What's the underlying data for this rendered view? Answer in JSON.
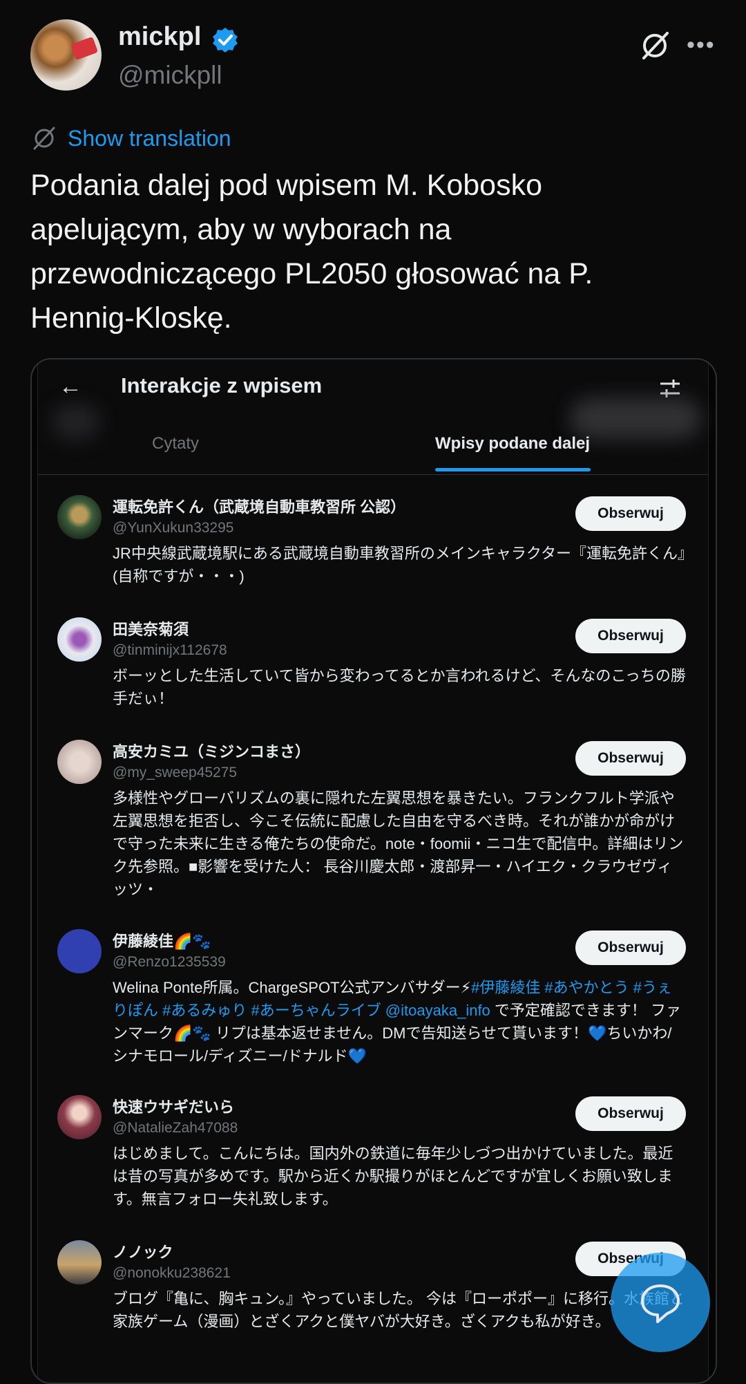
{
  "author": {
    "display_name": "mickpl",
    "handle": "@mickpll"
  },
  "translation": {
    "link_label": "Show translation"
  },
  "tweet": {
    "text": "Podania dalej pod wpisem M. Kobosko apelującym, aby w wyborach na przewodniczącego PL2050 głosować na P. Hennig-Kloskę."
  },
  "embedded": {
    "title": "Interakcje z wpisem",
    "tabs": [
      {
        "label": "Cytaty"
      },
      {
        "label": "Wpisy podane dalej"
      }
    ],
    "follow_label": "Obserwuj",
    "users": [
      {
        "name": "運転免許くん（武蔵境自動車教習所 公認）",
        "handle": "@YunXukun33295",
        "bio": "JR中央線武蔵境駅にある武蔵境自動車教習所のメインキャラクター『運転免許くん』(自称ですが・・・)"
      },
      {
        "name": "田美奈菊須",
        "handle": "@tinminijx112678",
        "bio": "ボーッとした生活していて皆から変わってるとか言われるけど、そんなのこっちの勝手だぃ！"
      },
      {
        "name": "高安カミユ（ミジンコまさ）",
        "handle": "@my_sweep45275",
        "bio": "多様性やグローバリズムの裏に隠れた左翼思想を暴きたい。フランクフルト学派や左翼思想を拒否し、今こそ伝統に配慮した自由を守るべき時。それが誰かが命がけで守った未来に生きる俺たちの使命だ。note・foomii・ニコ生で配信中。詳細はリンク先参照。■影響を受けた人： 長谷川慶太郎・渡部昇一・ハイエク・クラウゼヴィッツ・"
      },
      {
        "name": "伊藤綾佳🌈🐾",
        "handle": "@Renzo1235539",
        "bio_parts": [
          {
            "text": "Welina Ponte所属。ChargeSPOT公式アンバサダー⚡",
            "tag": false
          },
          {
            "text": "#伊藤綾佳 #あやかとう #うぇりぽん #あるみゅり #あーちゃんライブ @itoayaka_info",
            "tag": true
          },
          {
            "text": " で予定確認できます！ ファンマーク🌈🐾 リプは基本返せません。DMで告知送らせて貰います！💙ちいかわ/シナモロール/ディズニー/ドナルド💙",
            "tag": false
          }
        ]
      },
      {
        "name": "快速ウサギだいら",
        "handle": "@NatalieZah47088",
        "bio": "はじめまして。こんにちは。国内外の鉄道に毎年少しづつ出かけていました。最近は昔の写真が多めです。駅から近くか駅撮りがほとんどですが宜しくお願い致します。無言フォロー失礼致します。"
      },
      {
        "name": "ノノック",
        "handle": "@nonokku238621",
        "bio": "ブログ『亀に、胸キュン。』やっていました。 今は『ローポポー』に移行。水族館と家族ゲーム（漫画）とざくアクと僕ヤバが大好き。ざくアクも私が好き。"
      }
    ]
  },
  "icons": {
    "verified": "verified-badge-icon",
    "grok": "grok-icon",
    "more": "more-icon",
    "translate": "translate-icon",
    "back": "back-arrow-icon",
    "filter": "filter-icon",
    "compose": "compose-reply-icon"
  },
  "colors": {
    "accent": "#1d9bf0",
    "background": "#0a0a0a",
    "secondary_text": "#71767b"
  }
}
